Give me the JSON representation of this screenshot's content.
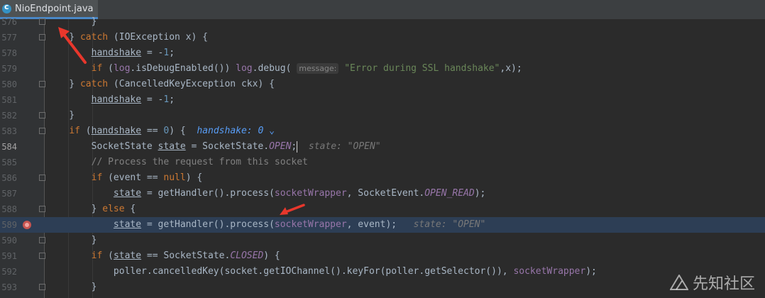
{
  "tab": {
    "label": "NioEndpoint.java",
    "icon": "java-class-icon"
  },
  "lines": [
    {
      "n": "576",
      "tokens": [
        [
          "p",
          "        }"
        ]
      ],
      "fold": true
    },
    {
      "n": "577",
      "tokens": [
        [
          "p",
          "    } "
        ],
        [
          "kw",
          "catch"
        ],
        [
          "p",
          " (IOException x) {"
        ]
      ],
      "fold": true
    },
    {
      "n": "578",
      "tokens": [
        [
          "p",
          "        "
        ],
        [
          "var",
          "handshake"
        ],
        [
          "p",
          " = -"
        ],
        [
          "num",
          "1"
        ],
        [
          "p",
          ";"
        ]
      ]
    },
    {
      "n": "579",
      "tokens": [
        [
          "p",
          "        "
        ],
        [
          "kw",
          "if"
        ],
        [
          "p",
          " ("
        ],
        [
          "fld",
          "log"
        ],
        [
          "p",
          ".isDebugEnabled()) "
        ],
        [
          "fld",
          "log"
        ],
        [
          "p",
          ".debug( "
        ],
        [
          "lbl",
          "message:"
        ],
        [
          "str",
          " \"Error during SSL handshake\""
        ],
        [
          "p",
          ",x);"
        ]
      ]
    },
    {
      "n": "580",
      "tokens": [
        [
          "p",
          "    } "
        ],
        [
          "kw",
          "catch"
        ],
        [
          "p",
          " (CancelledKeyException ckx) {"
        ]
      ],
      "fold": true
    },
    {
      "n": "581",
      "tokens": [
        [
          "p",
          "        "
        ],
        [
          "var",
          "handshake"
        ],
        [
          "p",
          " = -"
        ],
        [
          "num",
          "1"
        ],
        [
          "p",
          ";"
        ]
      ]
    },
    {
      "n": "582",
      "tokens": [
        [
          "p",
          "    }"
        ]
      ],
      "fold": true
    },
    {
      "n": "583",
      "tokens": [
        [
          "p",
          "    "
        ],
        [
          "kw",
          "if"
        ],
        [
          "p",
          " ("
        ],
        [
          "var",
          "handshake"
        ],
        [
          "p",
          " == "
        ],
        [
          "num",
          "0"
        ],
        [
          "p",
          ") {  "
        ],
        [
          "dbg",
          "handshake: 0"
        ],
        [
          "p",
          " "
        ],
        [
          "chev",
          "⌄"
        ]
      ],
      "fold": true
    },
    {
      "n": "584",
      "tokens": [
        [
          "p",
          "        SocketState "
        ],
        [
          "var",
          "state"
        ],
        [
          "p",
          " = SocketState."
        ],
        [
          "ital",
          "OPEN"
        ],
        [
          "p",
          ";"
        ],
        [
          "caret",
          ""
        ],
        [
          "hint",
          "  state: \"OPEN\""
        ]
      ],
      "current": true
    },
    {
      "n": "585",
      "tokens": [
        [
          "cmt",
          "        // Process the request from this socket"
        ]
      ]
    },
    {
      "n": "586",
      "tokens": [
        [
          "p",
          "        "
        ],
        [
          "kw",
          "if"
        ],
        [
          "p",
          " (event == "
        ],
        [
          "kw",
          "null"
        ],
        [
          "p",
          ") {"
        ]
      ],
      "fold": true
    },
    {
      "n": "587",
      "tokens": [
        [
          "p",
          "            "
        ],
        [
          "var",
          "state"
        ],
        [
          "p",
          " = getHandler().process("
        ],
        [
          "fld",
          "socketWrapper"
        ],
        [
          "p",
          ", SocketEvent."
        ],
        [
          "ital",
          "OPEN_READ"
        ],
        [
          "p",
          ");"
        ]
      ]
    },
    {
      "n": "588",
      "tokens": [
        [
          "p",
          "        } "
        ],
        [
          "kw",
          "else"
        ],
        [
          "p",
          " {"
        ]
      ],
      "fold": true
    },
    {
      "n": "589",
      "tokens": [
        [
          "p",
          "            "
        ],
        [
          "var",
          "state"
        ],
        [
          "p",
          " = getHandler().process("
        ],
        [
          "fld",
          "socketWrapper"
        ],
        [
          "p",
          ", event);"
        ],
        [
          "hint",
          "   state: \"OPEN\""
        ]
      ],
      "hl": true,
      "bp": true
    },
    {
      "n": "590",
      "tokens": [
        [
          "p",
          "        }"
        ]
      ],
      "fold": true
    },
    {
      "n": "591",
      "tokens": [
        [
          "p",
          "        "
        ],
        [
          "kw",
          "if"
        ],
        [
          "p",
          " ("
        ],
        [
          "var",
          "state"
        ],
        [
          "p",
          " == SocketState."
        ],
        [
          "ital",
          "CLOSED"
        ],
        [
          "p",
          ") {"
        ]
      ],
      "fold": true
    },
    {
      "n": "592",
      "tokens": [
        [
          "p",
          "            poller.cancelledKey(socket.getIOChannel().keyFor(poller.getSelector()), "
        ],
        [
          "fld",
          "socketWrapper"
        ],
        [
          "p",
          ");"
        ]
      ]
    },
    {
      "n": "593",
      "tokens": [
        [
          "p",
          "        }"
        ]
      ],
      "fold": true
    }
  ],
  "watermark": {
    "text": "先知社区"
  },
  "colors": {
    "background": "#2b2b2b",
    "highlight": "#2d3e55",
    "keyword": "#cc7832",
    "arrow": "#e8372c"
  }
}
